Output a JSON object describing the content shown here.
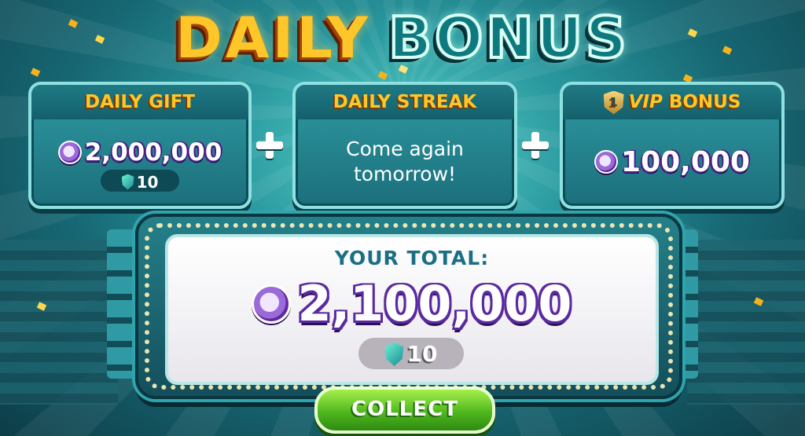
{
  "header": {
    "title_word1": "DAILY",
    "title_word2": "BONUS"
  },
  "daily_gift": {
    "title": "DAILY GIFT",
    "coins": "2,000,000",
    "gems": "10"
  },
  "daily_streak": {
    "title": "DAILY STREAK",
    "message_line1": "Come again",
    "message_line2": "tomorrow!"
  },
  "vip_bonus": {
    "level": "1",
    "vip_label": "VIP",
    "title": "BONUS",
    "coins": "100,000"
  },
  "total": {
    "label": "YOUR TOTAL:",
    "coins": "2,100,000",
    "gems": "10"
  },
  "actions": {
    "collect_label": "COLLECT"
  },
  "icons": [
    "chip-icon",
    "gem-icon",
    "plus-icon",
    "vip-shield-icon"
  ],
  "colors": {
    "gold": "#ffc629",
    "teal": "#1b6f7b",
    "chip_purple": "#5d2ba1",
    "collect_green": "#4fb81e"
  }
}
